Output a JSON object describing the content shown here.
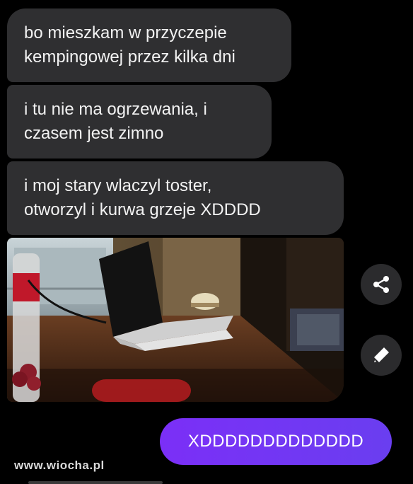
{
  "messages": {
    "received": [
      {
        "text": "bo mieszkam w przyczepie\nkempingowej przez kilka dni"
      },
      {
        "text": "i tu nie ma ogrzewania, i\nczasem jest zimno"
      },
      {
        "text": "i moj stary wlaczyl toster,\notworzyl i kurwa grzeje XDDDD"
      }
    ],
    "sent": [
      {
        "text": "XDDDDDDDDDDDDD"
      }
    ]
  },
  "actions": {
    "share_icon": "share-icon",
    "edit_icon": "pencil-icon"
  },
  "watermark": "www.wiocha.pl",
  "colors": {
    "background": "#000000",
    "received_bubble": "#2f2f31",
    "sent_bubble": "#7b2ff7",
    "text": "#f2f2f2"
  }
}
